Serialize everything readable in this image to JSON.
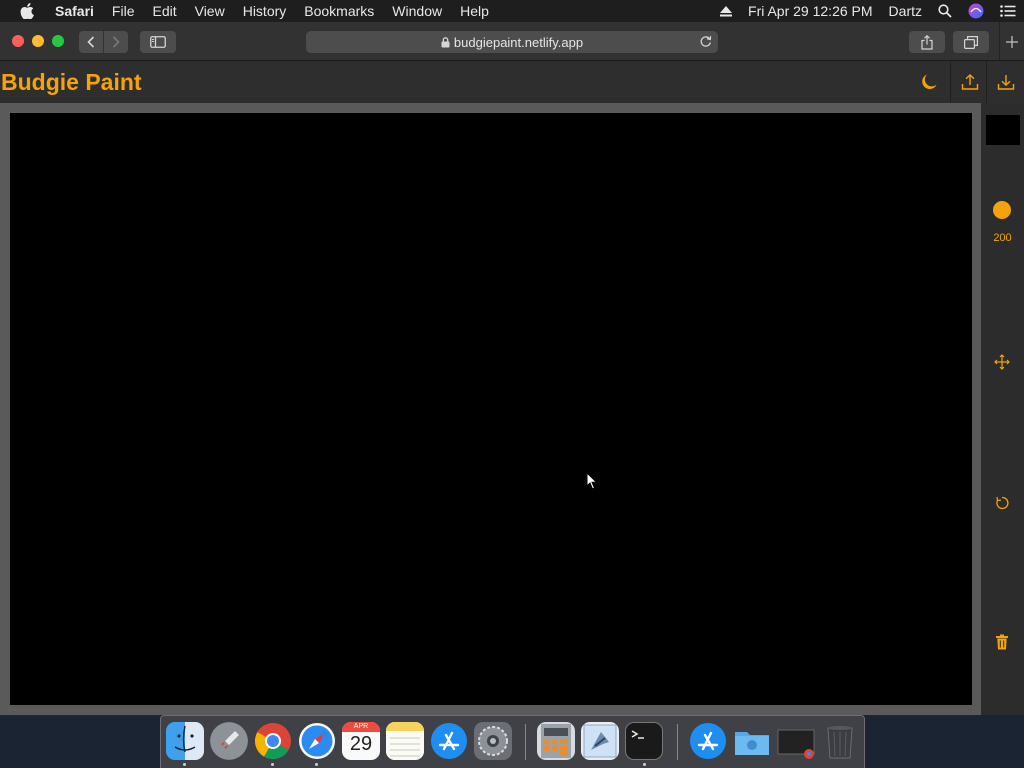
{
  "menubar": {
    "apple": "apple-logo",
    "items": [
      "Safari",
      "File",
      "Edit",
      "View",
      "History",
      "Bookmarks",
      "Window",
      "Help"
    ],
    "datetime": "Fri Apr 29  12:26 PM",
    "user": "Dartz"
  },
  "browser": {
    "url": "budgiepaint.netlify.app"
  },
  "app": {
    "title": "Budgie Paint",
    "accent": "#f5a30a",
    "canvas_color": "#000000",
    "selected_color": "#000000",
    "brush_size": "200"
  },
  "dock": {
    "calendar_month": "APR",
    "calendar_day": "29"
  }
}
